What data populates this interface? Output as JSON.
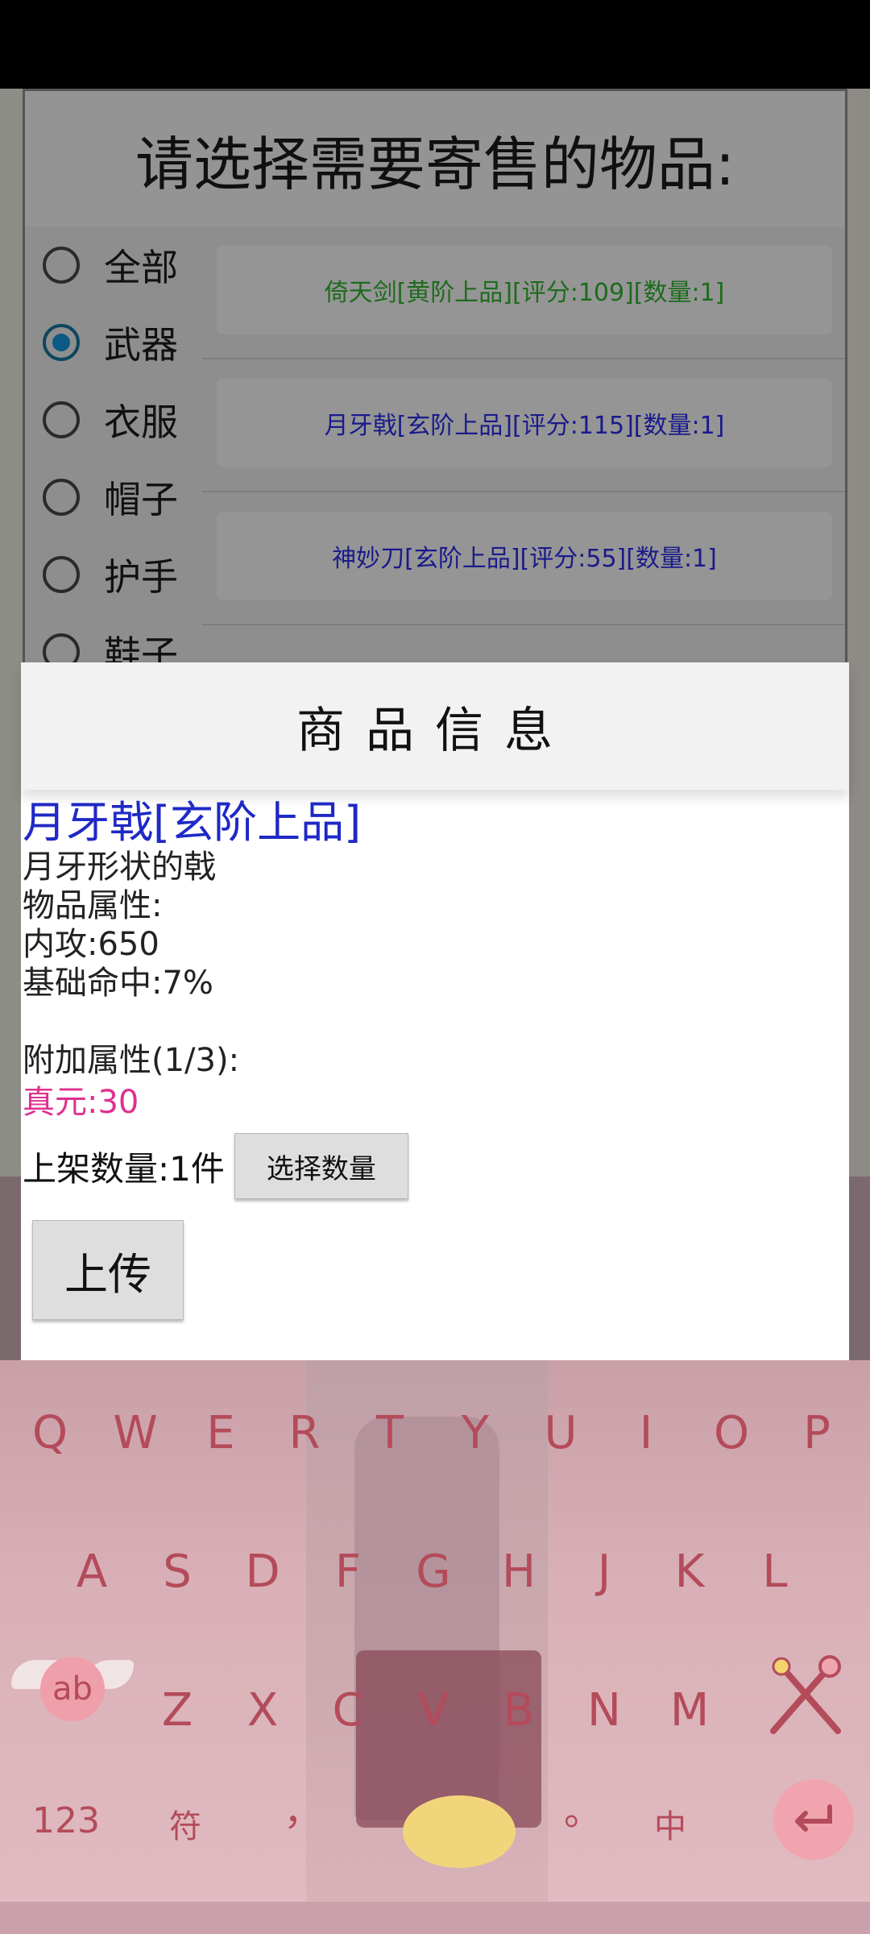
{
  "select_dialog": {
    "title": "请选择需要寄售的物品:",
    "categories": [
      {
        "label": "全部",
        "checked": false
      },
      {
        "label": "武器",
        "checked": true
      },
      {
        "label": "衣服",
        "checked": false
      },
      {
        "label": "帽子",
        "checked": false
      },
      {
        "label": "护手",
        "checked": false
      },
      {
        "label": "鞋子",
        "checked": false
      }
    ],
    "items": [
      {
        "text": "倚天剑[黄阶上品][评分:109][数量:1]",
        "color": "#1d6b1d"
      },
      {
        "text": "月牙戟[玄阶上品][评分:115][数量:1]",
        "color": "#1a1a8c"
      },
      {
        "text": "神妙刀[玄阶上品][评分:55][数量:1]",
        "color": "#1a1a8c"
      }
    ]
  },
  "info_dialog": {
    "header": "商品信息",
    "item_name": "月牙戟[玄阶上品]",
    "description": "月牙形状的戟",
    "attributes_label": "物品属性:",
    "attr_inner_attack": "内攻:650",
    "attr_base_hit": "基础命中:7%",
    "extra_attributes_label": "附加属性(1/3):",
    "extra_attr_1": "真元:30",
    "quantity_text": "上架数量:1件",
    "select_quantity_button": "选择数量",
    "upload_button": "上传",
    "name_color": "#1f29c6",
    "extra_color": "#e0308e"
  },
  "keyboard": {
    "row1": [
      "Q",
      "W",
      "E",
      "R",
      "T",
      "Y",
      "U",
      "I",
      "O",
      "P"
    ],
    "row2": [
      "A",
      "S",
      "D",
      "F",
      "G",
      "H",
      "J",
      "K",
      "L"
    ],
    "row3": [
      "Z",
      "X",
      "C",
      "V",
      "B",
      "N",
      "M"
    ],
    "ab_key": "ab",
    "num_key": "123",
    "sym_key": "符",
    "comma_key": "，",
    "period_key": "。",
    "lang_key": "中",
    "key_color": "#b44b5a"
  }
}
